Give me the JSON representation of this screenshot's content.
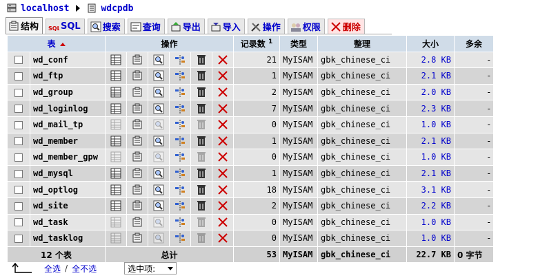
{
  "breadcrumb": {
    "server": "localhost",
    "database": "wdcpdb"
  },
  "tabs": [
    {
      "label": "结构",
      "icon": "structure-icon",
      "active": true
    },
    {
      "label": "SQL",
      "icon": "sql-icon"
    },
    {
      "label": "搜索",
      "icon": "search-icon"
    },
    {
      "label": "查询",
      "icon": "query-icon"
    },
    {
      "label": "导出",
      "icon": "export-icon"
    },
    {
      "label": "导入",
      "icon": "import-icon"
    },
    {
      "label": "操作",
      "icon": "operations-icon"
    },
    {
      "label": "权限",
      "icon": "privileges-icon"
    },
    {
      "label": "删除",
      "icon": "drop-icon",
      "danger": true
    }
  ],
  "table": {
    "headers": {
      "table": "表",
      "actions": "操作",
      "records": "记录数",
      "records_sup": "1",
      "type": "类型",
      "collation": "整理",
      "size": "大小",
      "overhead": "多余"
    },
    "rows": [
      {
        "name": "wd_conf",
        "records": "21",
        "type": "MyISAM",
        "collation": "gbk_chinese_ci",
        "size": "2.8 KB",
        "overhead": "-",
        "empty": false
      },
      {
        "name": "wd_ftp",
        "records": "1",
        "type": "MyISAM",
        "collation": "gbk_chinese_ci",
        "size": "2.1 KB",
        "overhead": "-",
        "empty": false
      },
      {
        "name": "wd_group",
        "records": "2",
        "type": "MyISAM",
        "collation": "gbk_chinese_ci",
        "size": "2.0 KB",
        "overhead": "-",
        "empty": false
      },
      {
        "name": "wd_loginlog",
        "records": "7",
        "type": "MyISAM",
        "collation": "gbk_chinese_ci",
        "size": "2.3 KB",
        "overhead": "-",
        "empty": false
      },
      {
        "name": "wd_mail_tp",
        "records": "0",
        "type": "MyISAM",
        "collation": "gbk_chinese_ci",
        "size": "1.0 KB",
        "overhead": "-",
        "empty": true
      },
      {
        "name": "wd_member",
        "records": "1",
        "type": "MyISAM",
        "collation": "gbk_chinese_ci",
        "size": "2.1 KB",
        "overhead": "-",
        "empty": false
      },
      {
        "name": "wd_member_gpw",
        "records": "0",
        "type": "MyISAM",
        "collation": "gbk_chinese_ci",
        "size": "1.0 KB",
        "overhead": "-",
        "empty": true
      },
      {
        "name": "wd_mysql",
        "records": "1",
        "type": "MyISAM",
        "collation": "gbk_chinese_ci",
        "size": "2.1 KB",
        "overhead": "-",
        "empty": false
      },
      {
        "name": "wd_optlog",
        "records": "18",
        "type": "MyISAM",
        "collation": "gbk_chinese_ci",
        "size": "3.1 KB",
        "overhead": "-",
        "empty": false
      },
      {
        "name": "wd_site",
        "records": "2",
        "type": "MyISAM",
        "collation": "gbk_chinese_ci",
        "size": "2.2 KB",
        "overhead": "-",
        "empty": false
      },
      {
        "name": "wd_task",
        "records": "0",
        "type": "MyISAM",
        "collation": "gbk_chinese_ci",
        "size": "1.0 KB",
        "overhead": "-",
        "empty": true
      },
      {
        "name": "wd_tasklog",
        "records": "0",
        "type": "MyISAM",
        "collation": "gbk_chinese_ci",
        "size": "1.0 KB",
        "overhead": "-",
        "empty": true
      }
    ],
    "footer": {
      "count": "12 个表",
      "total_label": "总计",
      "records": "53",
      "type": "MyISAM",
      "collation": "gbk_chinese_ci",
      "size": "22.7 KB",
      "overhead": "0 字节"
    }
  },
  "bottom": {
    "check_all": "全选",
    "uncheck_all": "全不选",
    "select_placeholder": "选中项:"
  },
  "colors": {
    "link": "#0000cc",
    "header_bg": "#d0dce8",
    "row_odd": "#e5e5e5",
    "row_even": "#d5d5d5",
    "drop_red": "#cc0000"
  }
}
